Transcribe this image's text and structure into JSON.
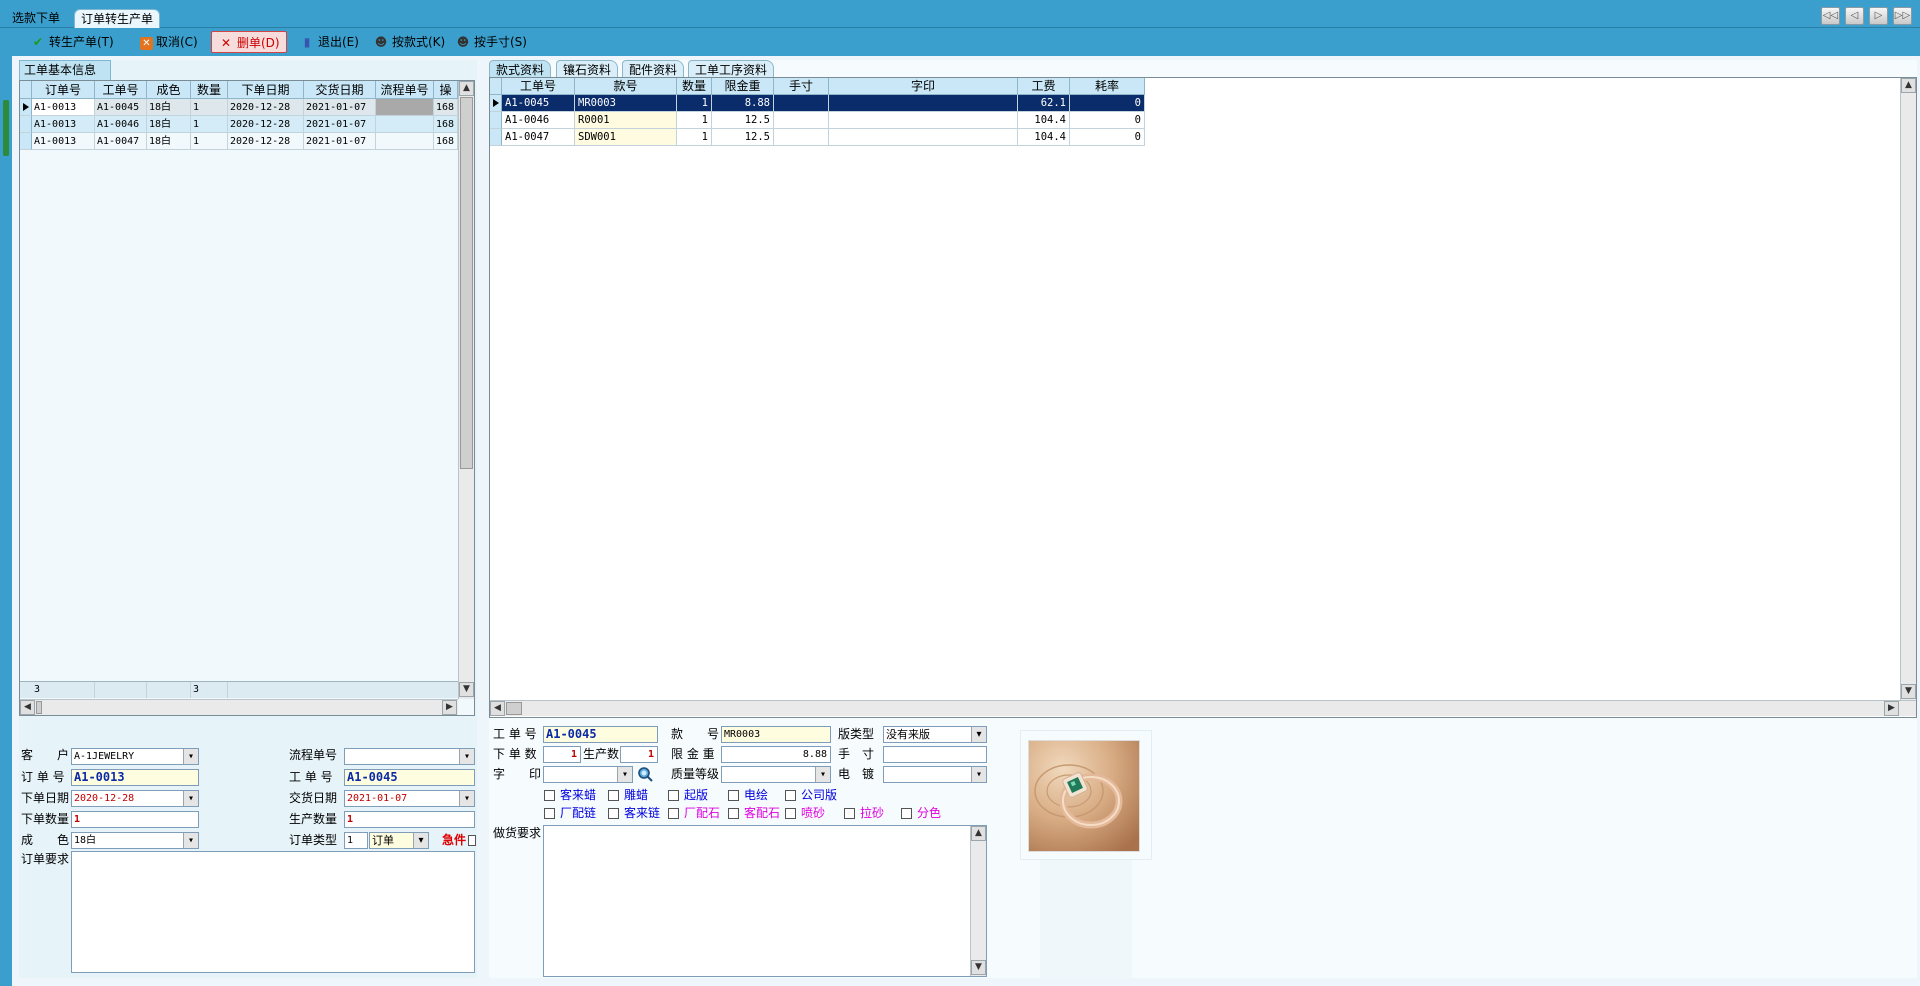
{
  "tabs": [
    {
      "label": "选款下单"
    },
    {
      "label": "订单转生产单"
    }
  ],
  "toolbar": {
    "convert": "转生产单(T)",
    "cancel": "取消(C)",
    "delete": "删单(D)",
    "exit": "退出(E)",
    "by_style": "按款式(K)",
    "by_size": "按手寸(S)"
  },
  "nav": {
    "first": "◁◁",
    "prev": "◁",
    "next": "▷",
    "last": "▷▷"
  },
  "left": {
    "panel_title": "工单基本信息",
    "columns": [
      "订单号",
      "工单号",
      "成色",
      "数量",
      "下单日期",
      "交货日期",
      "流程单号",
      "操作"
    ],
    "rows": [
      {
        "order": "A1-0013",
        "work": "A1-0045",
        "color": "18白",
        "qty": "1",
        "odate": "2020-12-28",
        "ddate": "2021-01-07",
        "flow": "",
        "op": "168"
      },
      {
        "order": "A1-0013",
        "work": "A1-0046",
        "color": "18白",
        "qty": "1",
        "odate": "2020-12-28",
        "ddate": "2021-01-07",
        "flow": "",
        "op": "168"
      },
      {
        "order": "A1-0013",
        "work": "A1-0047",
        "color": "18白",
        "qty": "1",
        "odate": "2020-12-28",
        "ddate": "2021-01-07",
        "flow": "",
        "op": "168"
      }
    ],
    "footer_count": "3",
    "footer_qty": "3",
    "form": {
      "customer_label": "客　　户",
      "customer": "A-1JEWELRY",
      "flow_label": "流程单号",
      "flow": "",
      "order_no_label": "订 单 号",
      "order_no": "A1-0013",
      "work_no_label": "工 单 号",
      "work_no": "A1-0045",
      "order_date_label": "下单日期",
      "order_date": "2020-12-28",
      "delivery_label": "交货日期",
      "delivery": "2021-01-07",
      "order_qty_label": "下单数量",
      "order_qty": "1",
      "prod_qty_label": "生产数量",
      "prod_qty": "1",
      "color_label": "成　　色",
      "color": "18白",
      "type_label": "订单类型",
      "type_code": "1",
      "type": "订单",
      "urgent": "急件",
      "remark_label": "订单要求"
    }
  },
  "right": {
    "tabs": [
      "款式资料",
      "镶石资料",
      "配件资料",
      "工单工序资料"
    ],
    "columns": [
      "工单号",
      "款号",
      "数量",
      "限金重",
      "手寸",
      "字印",
      "工费",
      "耗率"
    ],
    "rows": [
      {
        "work": "A1-0045",
        "style": "MR0003",
        "qty": "1",
        "weight": "8.88",
        "size": "",
        "stamp": "",
        "fee": "62.1",
        "loss": "0"
      },
      {
        "work": "A1-0046",
        "style": "R0001",
        "qty": "1",
        "weight": "12.5",
        "size": "",
        "stamp": "",
        "fee": "104.4",
        "loss": "0"
      },
      {
        "work": "A1-0047",
        "style": "SDW001",
        "qty": "1",
        "weight": "12.5",
        "size": "",
        "stamp": "",
        "fee": "104.4",
        "loss": "0"
      }
    ],
    "form": {
      "work_label": "工 单 号",
      "work": "A1-0045",
      "style_label": "款　　号",
      "style": "MR0003",
      "version_label": "版类型",
      "version": "没有来版",
      "order_count_label": "下 单 数",
      "order_count": "1",
      "prod_count_label": "生产数",
      "prod_count": "1",
      "weight_label": "限 金 重",
      "weight": "8.88",
      "size_label": "手　寸",
      "size": "",
      "stamp_label": "字　　印",
      "stamp": "",
      "quality_label": "质量等级",
      "quality": "",
      "plating_label": "电　镀",
      "plating": "",
      "checks": [
        "客来蜡",
        "雕蜡",
        "起版",
        "电绘",
        "公司版",
        "厂配链",
        "客来链",
        "厂配石",
        "客配石",
        "喷砂",
        "拉砂",
        "分色"
      ],
      "remark_label": "做货要求"
    }
  }
}
